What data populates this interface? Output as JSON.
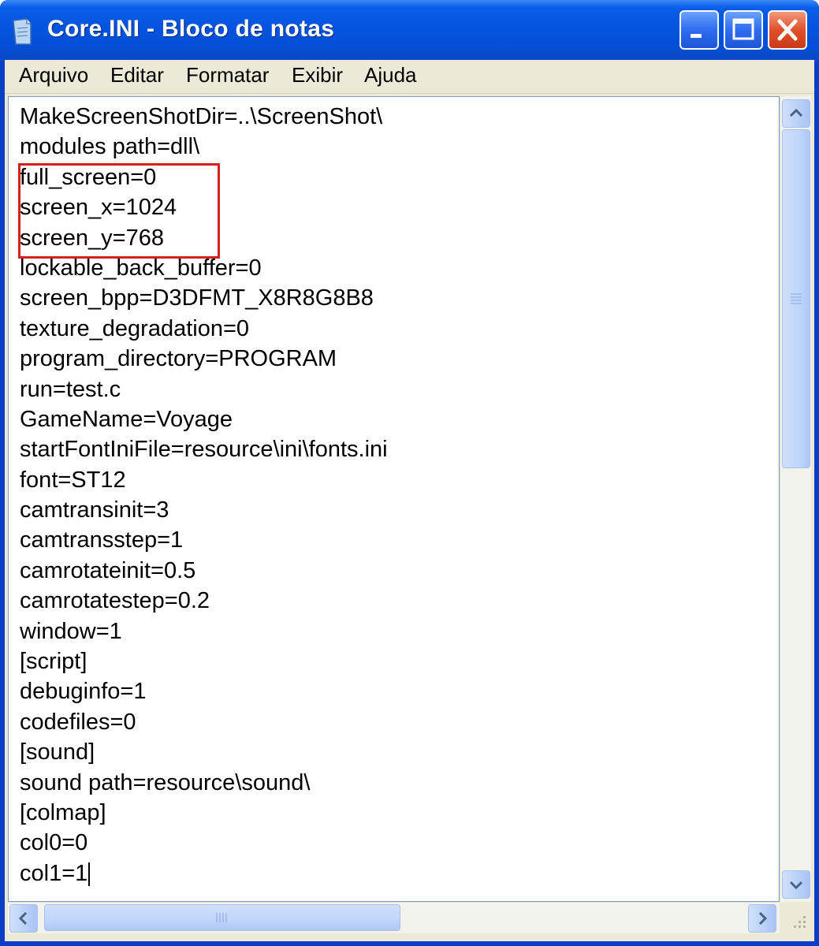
{
  "window": {
    "title": "Core.INI - Bloco de notas",
    "icon": "notepad-icon",
    "controls": [
      "minimize-icon",
      "maximize-icon",
      "close-icon"
    ],
    "accent_color": "#0a5ee8",
    "close_color": "#e0502a"
  },
  "menu": {
    "items": [
      "Arquivo",
      "Editar",
      "Formatar",
      "Exibir",
      "Ajuda"
    ]
  },
  "editor": {
    "lines": [
      "MakeScreenShotDir=..\\ScreenShot\\",
      "modules path=dll\\",
      "full_screen=0",
      "screen_x=1024",
      "screen_y=768",
      "lockable_back_buffer=0",
      "screen_bpp=D3DFMT_X8R8G8B8",
      "texture_degradation=0",
      "program_directory=PROGRAM",
      "run=test.c",
      "GameName=Voyage",
      "startFontIniFile=resource\\ini\\fonts.ini",
      "font=ST12",
      "camtransinit=3",
      "camtransstep=1",
      "camrotateinit=0.5",
      "camrotatestep=0.2",
      "window=1",
      "[script]",
      "debuginfo=1",
      "codefiles=0",
      "[sound]",
      "sound path=resource\\sound\\",
      "[colmap]",
      "col0=0",
      "col1=1"
    ],
    "caret_line": 25,
    "highlight_color": "#d42020"
  }
}
